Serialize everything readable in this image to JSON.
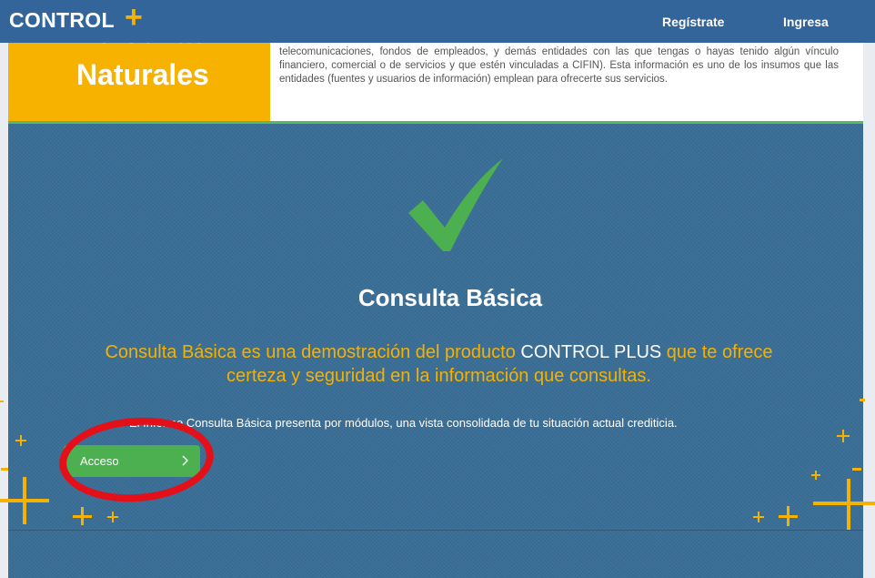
{
  "header": {
    "logo_text": "CONTROL",
    "logo_plus": "+",
    "nav": {
      "register_label": "Regístrate",
      "login_label": "Ingresa"
    }
  },
  "hero": {
    "title_line1": "Personas",
    "title_line2": "Naturales",
    "text": "telecomunicaciones, fondos de empleados, y demás entidades con las que tengas o hayas tenido algún vínculo financiero, comercial o de servicios y que estén vinculadas a CIFIN). Esta información es uno de los insumos que las entidades (fuentes y usuarios de información) emplean para ofrecerte sus servicios."
  },
  "main": {
    "icon": "checkmark-icon",
    "title": "Consulta Básica",
    "subtitle_part1": "Consulta Básica es una demostración del producto ",
    "subtitle_brand": "CONTROL PLUS",
    "subtitle_part2": " que te ofrece certeza y seguridad en la información que consultas.",
    "description": "El Informe Consulta Básica presenta por módulos, una vista consolidada de tu situación actual crediticia.",
    "button_label": "Acceso",
    "button_icon": "chevron-right-icon"
  },
  "colors": {
    "topbar": "#34659a",
    "accent_yellow": "#f7b200",
    "panel_blue": "#3a6e96",
    "button_green": "#4caf50",
    "checkmark_green": "#4caf50",
    "annotation_red": "#e3101a"
  }
}
